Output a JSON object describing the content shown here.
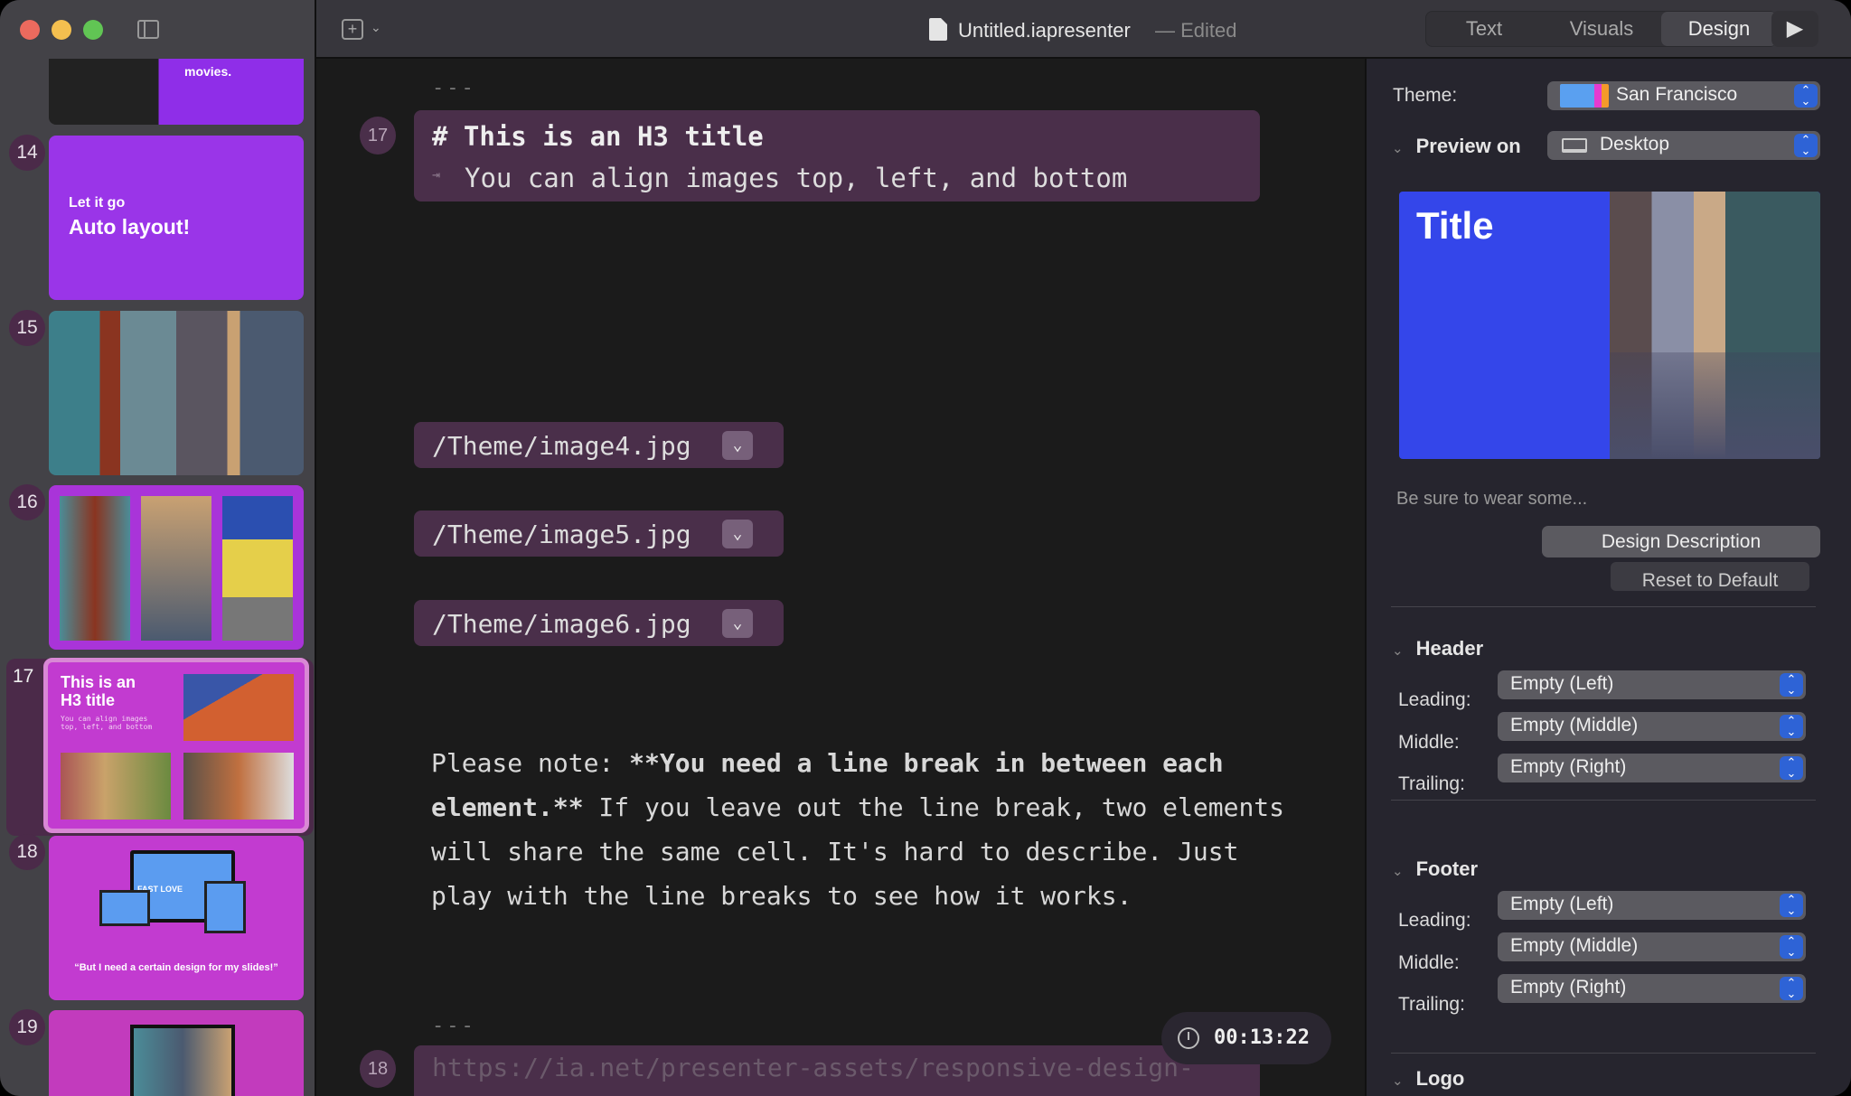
{
  "window": {
    "title": "Untitled.iapresenter",
    "status": "— Edited"
  },
  "toolbar": {
    "tabs": [
      {
        "label": "Text"
      },
      {
        "label": "Visuals"
      },
      {
        "label": "Design",
        "selected": true
      }
    ],
    "play": "play-icon"
  },
  "sidebar": {
    "slides": [
      {
        "number": "",
        "caption": "movies."
      },
      {
        "number": "14",
        "subtitle": "Let it go",
        "title": "Auto layout!"
      },
      {
        "number": "15"
      },
      {
        "number": "16"
      },
      {
        "number": "17",
        "title": "This is an H3 title",
        "text": "You can align images top, left, and bottom",
        "selected": true
      },
      {
        "number": "18",
        "caption": "“But I need a certain design for my slides!”",
        "device_text": "FAST LOVE"
      },
      {
        "number": "19"
      }
    ]
  },
  "editor": {
    "separator": "---",
    "slide17": {
      "number": "17",
      "heading": "# This is an H3 title",
      "tab_marker": "⇥",
      "subtitle": "You can align images top, left, and bottom"
    },
    "images": [
      "/Theme/image4.jpg",
      "/Theme/image5.jpg",
      "/Theme/image6.jpg"
    ],
    "note": {
      "prefix": "Please note: ",
      "bold": "**You need a line break in between each element.**",
      "rest": " If you leave out the line break, two elements will share the same cell. It's hard to describe. Just play with the line breaks to see how it works."
    },
    "separator2": "---",
    "slide18": {
      "number": "18",
      "url": "https://ia.net/presenter-assets/responsive-design-"
    },
    "timer": "00:13:22"
  },
  "design": {
    "theme_label": "Theme:",
    "theme_value": "San Francisco",
    "preview_label": "Preview on",
    "preview_value": "Desktop",
    "preview_title": "Title",
    "description": "Be sure to wear some...",
    "design_description_button": "Design Description",
    "reset_button": "Reset to Default",
    "header": {
      "title": "Header",
      "rows": [
        {
          "label": "Leading:",
          "value": "Empty (Left)"
        },
        {
          "label": "Middle:",
          "value": "Empty (Middle)"
        },
        {
          "label": "Trailing:",
          "value": "Empty (Right)"
        }
      ]
    },
    "footer": {
      "title": "Footer",
      "rows": [
        {
          "label": "Leading:",
          "value": "Empty (Left)"
        },
        {
          "label": "Middle:",
          "value": "Empty (Middle)"
        },
        {
          "label": "Trailing:",
          "value": "Empty (Right)"
        }
      ]
    },
    "logo": {
      "title": "Logo"
    }
  },
  "colors": {
    "accent": "#2e63d6",
    "slide_purple": "#9a35e8",
    "slide_magenta": "#c23bd0",
    "preview_blue": "#3446ea",
    "block": "#4a2f4a"
  }
}
